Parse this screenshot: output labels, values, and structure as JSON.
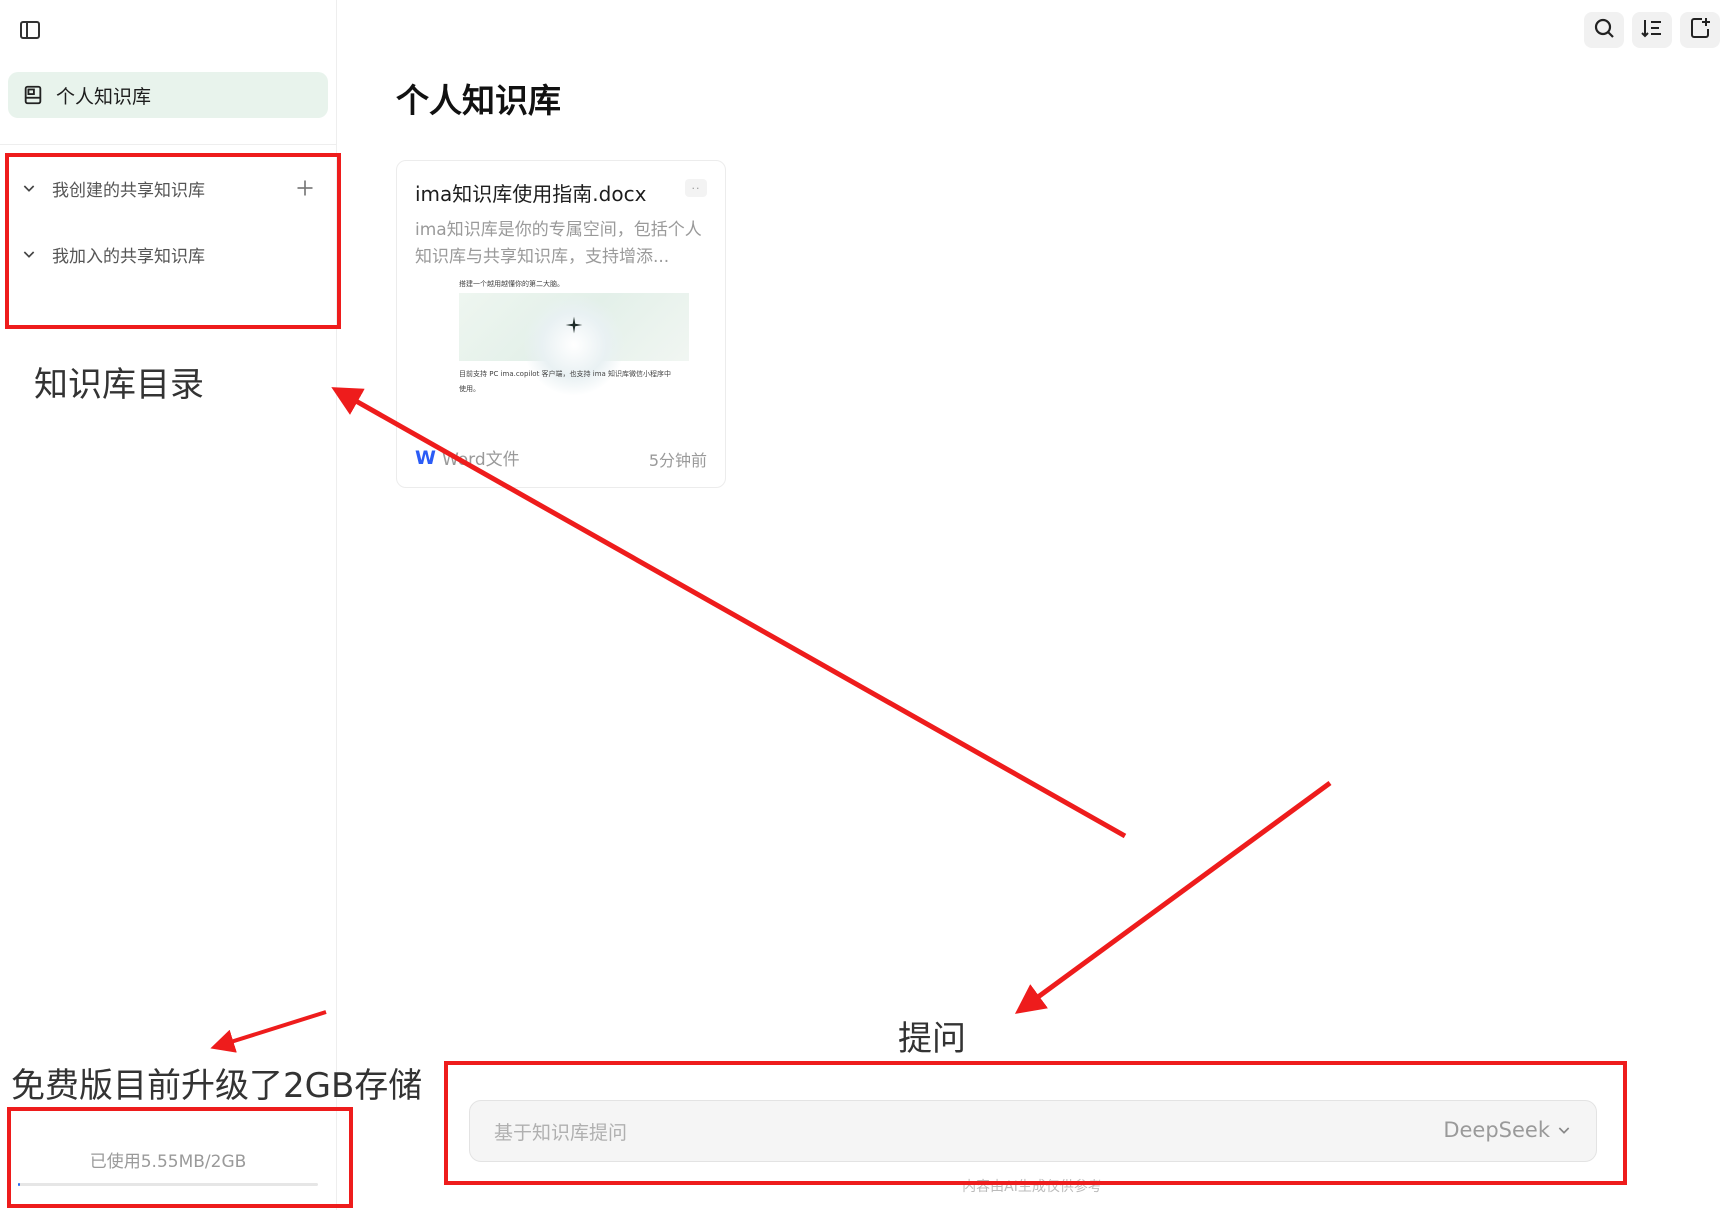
{
  "sidebar": {
    "personal_kb_label": "个人知识库",
    "sections": [
      {
        "label": "我创建的共享知识库"
      },
      {
        "label": "我加入的共享知识库"
      }
    ],
    "storage": {
      "text": "已使用5.55MB/2GB",
      "used_fraction": 0.0027
    }
  },
  "toolbar": {
    "icons": [
      "search-icon",
      "sort-icon",
      "add-note-icon"
    ]
  },
  "main": {
    "title": "个人知识库",
    "documents": [
      {
        "title": "ima知识库使用指南.docx",
        "description": "ima知识库是你的专属空间，包括个人知识库与共享知识库，支持增添...",
        "preview_line_1": "搭建一个越用越懂你的第二大脑。",
        "preview_line_2": "目前支持 PC ima.copilot 客户端，也支持 ima 知识库微信小程序中",
        "preview_line_3": "使用。",
        "type_badge": "W",
        "type_label": "Word文件",
        "time": "5分钟前"
      }
    ]
  },
  "ask": {
    "placeholder": "基于知识库提问",
    "model": "DeepSeek",
    "disclaimer": "内容由AI生成仅供参考"
  },
  "annotations": {
    "kb_directory": "知识库目录",
    "ask_label": "提问",
    "storage_note": "免费版目前升级了2GB存储",
    "color": "#ee1c1c"
  }
}
